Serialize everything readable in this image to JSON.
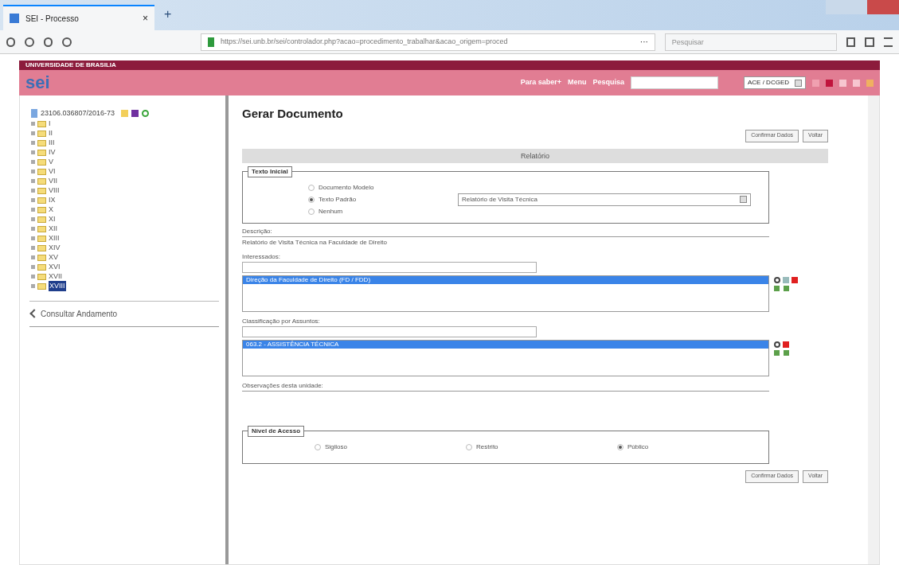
{
  "browser": {
    "tab_title": "SEI - Processo",
    "tab_close": "×",
    "new_tab": "+",
    "url": "https://sei.unb.br/sei/controlador.php?acao=procedimento_trabalhar&acao_origem=proced",
    "url_more": "···",
    "search_placeholder": "Pesquisar"
  },
  "header": {
    "institution": "UNIVERSIDADE DE BRASILIA",
    "logo": "sei",
    "menu": [
      "Para saber+",
      "Menu",
      "Pesquisa"
    ],
    "unit": "ACE / DCGED"
  },
  "tree": {
    "label": "23106.036807/2016-73",
    "children": [
      {
        "label": "I",
        "selected": false
      },
      {
        "label": "II",
        "selected": false
      },
      {
        "label": "III",
        "selected": false
      },
      {
        "label": "IV",
        "selected": false
      },
      {
        "label": "V",
        "selected": false
      },
      {
        "label": "VI",
        "selected": false
      },
      {
        "label": "VII",
        "selected": false
      },
      {
        "label": "VIII",
        "selected": false
      },
      {
        "label": "IX",
        "selected": false
      },
      {
        "label": "X",
        "selected": false
      },
      {
        "label": "XI",
        "selected": false
      },
      {
        "label": "XII",
        "selected": false
      },
      {
        "label": "XIII",
        "selected": false
      },
      {
        "label": "XIV",
        "selected": false
      },
      {
        "label": "XV",
        "selected": false
      },
      {
        "label": "XVI",
        "selected": false
      },
      {
        "label": "XVII",
        "selected": false
      },
      {
        "label": "XVIII",
        "selected": true
      }
    ]
  },
  "sidebar_link": "Consultar Andamento",
  "form": {
    "title": "Gerar Documento",
    "buttons": [
      "Confirmar Dados",
      "Voltar"
    ],
    "doc_type": "Relatório",
    "texto_inicial": {
      "legend": "Texto Inicial",
      "options": [
        {
          "label": "Documento Modelo",
          "selected": false
        },
        {
          "label": "Texto Padrão",
          "selected": true
        },
        {
          "label": "Nenhum",
          "selected": false
        }
      ],
      "select_value": "Relatório de Visita Técnica"
    },
    "descricao": {
      "label": "Descrição:",
      "value": "Relatório de Visita Técnica na Faculdade de Direito"
    },
    "interessados": {
      "label": "Interessados:",
      "items": [
        {
          "label": "Direção da Faculdade de Direito (FD / FDD)",
          "selected": true
        }
      ]
    },
    "classificacao": {
      "label": "Classificação por Assuntos:",
      "items": [
        {
          "label": "063.2 - ASSISTÊNCIA TÉCNICA",
          "selected": true
        }
      ]
    },
    "observacoes": {
      "label": "Observações desta unidade:"
    },
    "nivel_acesso": {
      "legend": "Nível de Acesso",
      "options": [
        {
          "label": "Sigiloso",
          "selected": false
        },
        {
          "label": "Restrito",
          "selected": false
        },
        {
          "label": "Público",
          "selected": true
        }
      ]
    },
    "bottom_buttons": [
      "Confirmar Dados",
      "Voltar"
    ]
  }
}
